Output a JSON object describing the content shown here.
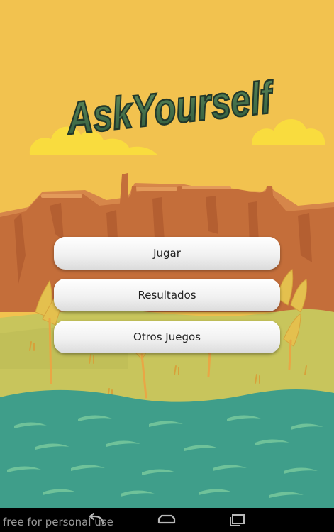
{
  "app": {
    "logo_text": "AskYourself"
  },
  "menu": {
    "play_label": "Jugar",
    "results_label": "Resultados",
    "other_games_label": "Otros Juegos"
  },
  "watermark": {
    "text": "free for personal use"
  },
  "navbar": {
    "back_icon": "back-arrow-icon",
    "home_icon": "home-icon",
    "recents_icon": "recent-apps-icon"
  },
  "colors": {
    "sky": "#f2c24f",
    "cliff": "#c9733e",
    "grass": "#c7c55b",
    "water": "#3f9e8a",
    "logo_text": "#3e6a4a",
    "navbar": "#000000"
  }
}
